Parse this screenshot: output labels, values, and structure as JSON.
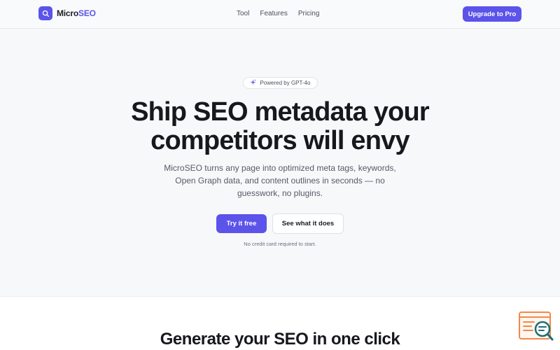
{
  "header": {
    "brand_prefix": "Micro",
    "brand_suffix": "SEO",
    "nav": [
      "Tool",
      "Features",
      "Pricing"
    ],
    "upgrade_label": "Upgrade to Pro"
  },
  "hero": {
    "badge": "Powered by GPT-4o",
    "headline_line1": "Ship SEO metadata your",
    "headline_line2": "competitors will envy",
    "subtext": "MicroSEO turns any page into optimized meta tags, keywords, Open Graph data, and content outlines in seconds — no guesswork, no plugins.",
    "primary_cta": "Try it free",
    "secondary_cta": "See what it does",
    "note": "No credit card required to start."
  },
  "section": {
    "title": "Generate your SEO in one click"
  },
  "colors": {
    "accent": "#5b53ea",
    "widget_orange": "#f08a4b",
    "widget_teal": "#1f6f73"
  },
  "icons": {
    "brand": "search-icon",
    "badge": "sparkle-icon",
    "widget": "seo-magnifier-icon"
  }
}
